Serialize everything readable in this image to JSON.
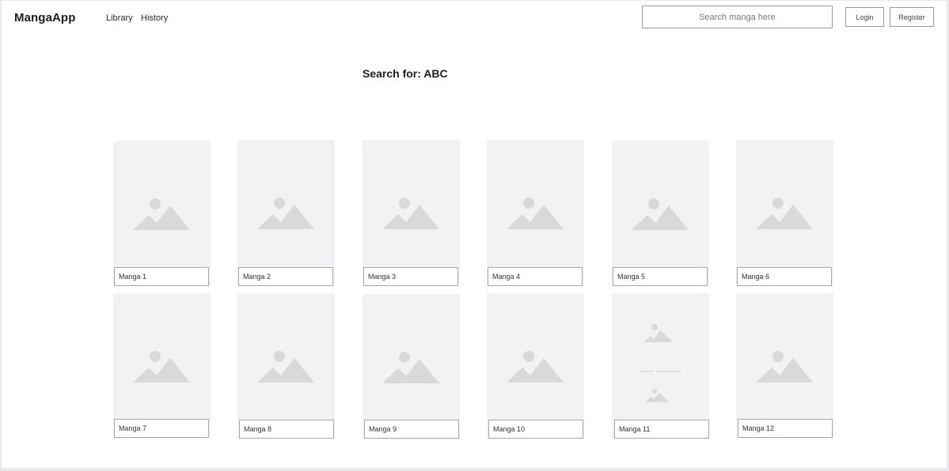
{
  "header": {
    "brand": "MangaApp",
    "nav": [
      {
        "label": "Library"
      },
      {
        "label": "History"
      }
    ],
    "search": {
      "placeholder": "Search manga here",
      "value": ""
    },
    "login_label": "Login",
    "register_label": "Register"
  },
  "main": {
    "heading": "Search for: ABC"
  },
  "results": [
    {
      "title": "Manga 1",
      "thumbnail": "image-placeholder-icon"
    },
    {
      "title": "Manga 2",
      "thumbnail": "image-placeholder-icon"
    },
    {
      "title": "Manga 3",
      "thumbnail": "image-placeholder-icon"
    },
    {
      "title": "Manga 4",
      "thumbnail": "image-placeholder-icon"
    },
    {
      "title": "Manga 5",
      "thumbnail": "image-placeholder-icon"
    },
    {
      "title": "Manga 6",
      "thumbnail": "image-placeholder-icon"
    },
    {
      "title": "Manga 7",
      "thumbnail": "image-placeholder-icon"
    },
    {
      "title": "Manga 8",
      "thumbnail": "image-placeholder-icon"
    },
    {
      "title": "Manga 9",
      "thumbnail": "image-placeholder-icon"
    },
    {
      "title": "Manga 10",
      "thumbnail": "image-placeholder-icon"
    },
    {
      "title": "Manga 11",
      "thumbnail": "image-gallery-placeholder-icon"
    },
    {
      "title": "Manga 12",
      "thumbnail": "image-placeholder-icon"
    }
  ],
  "colors": {
    "card_background": "#f2f2f4",
    "placeholder_icon": "#d9d9dc",
    "border": "#9a9a9a"
  }
}
